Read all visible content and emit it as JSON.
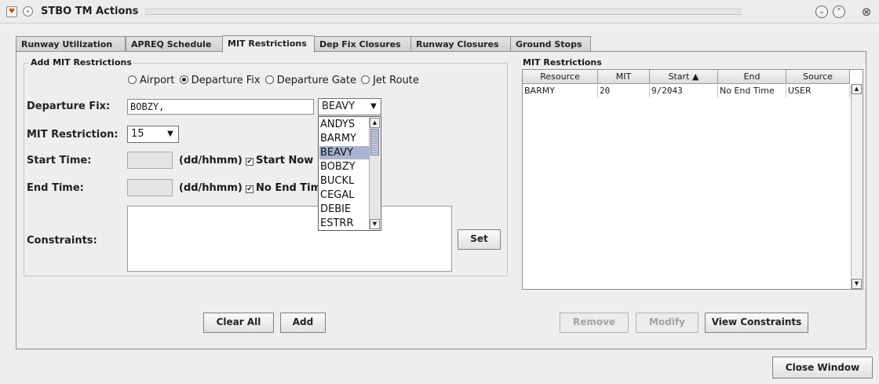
{
  "window": {
    "title": "STBO TM Actions"
  },
  "tabs": [
    "Runway Utilization",
    "APREQ Schedule",
    "MIT Restrictions",
    "Dep Fix Closures",
    "Runway Closures",
    "Ground Stops"
  ],
  "add_section": {
    "title": "Add MIT Restrictions",
    "radio_options": [
      "Airport",
      "Departure Fix",
      "Departure Gate",
      "Jet Route"
    ],
    "selected_radio": "Departure Fix",
    "departure_fix_label": "Departure Fix:",
    "departure_fix_value": "BOBZY,",
    "fix_combo_value": "BEAVY",
    "mit_label": "MIT Restriction:",
    "mit_value": "15",
    "start_label": "Start Time:",
    "start_format": "(dd/hhmm)",
    "start_now_label": "Start Now",
    "end_label": "End Time:",
    "end_format": "(dd/hhmm)",
    "no_end_label": "No End Tim",
    "constraints_label": "Constraints:",
    "set_button": "Set",
    "clear_button": "Clear All",
    "add_button": "Add"
  },
  "fix_dropdown": {
    "items": [
      "ANDYS",
      "BARMY",
      "BEAVY",
      "BOBZY",
      "BUCKL",
      "CEGAL",
      "DEBIE",
      "ESTRR"
    ],
    "selected": "BEAVY"
  },
  "restrictions": {
    "title": "MIT Restrictions",
    "columns": [
      "Resource",
      "MIT",
      "Start ▲",
      "End",
      "Source"
    ],
    "rows": [
      [
        "BARMY",
        "20",
        "9/2043",
        "No End Time",
        "USER"
      ]
    ],
    "remove_button": "Remove",
    "modify_button": "Modify",
    "view_button": "View Constraints"
  },
  "close_button": "Close Window"
}
